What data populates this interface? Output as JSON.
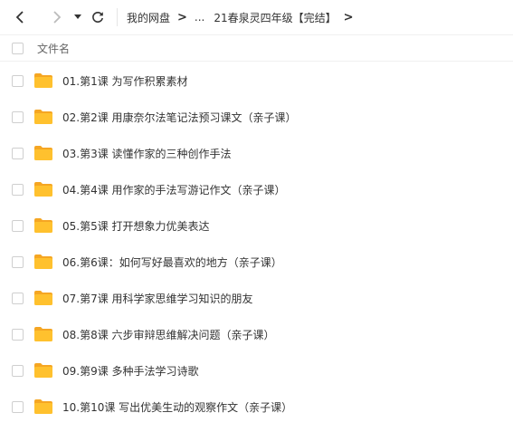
{
  "toolbar": {
    "breadcrumb": {
      "root": "我的网盘",
      "ellipsis": "...",
      "current": "21春泉灵四年级【完结】"
    }
  },
  "list_header": {
    "name_column": "文件名"
  },
  "files": [
    {
      "name": "01.第1课 为写作积累素材"
    },
    {
      "name": "02.第2课 用康奈尔法笔记法预习课文（亲子课）"
    },
    {
      "name": "03.第3课 读懂作家的三种创作手法"
    },
    {
      "name": "04.第4课 用作家的手法写游记作文（亲子课）"
    },
    {
      "name": "05.第5课 打开想象力优美表达"
    },
    {
      "name": "06.第6课：如何写好最喜欢的地方（亲子课）"
    },
    {
      "name": "07.第7课 用科学家思维学习知识的朋友"
    },
    {
      "name": "08.第8课 六步审辩思维解决问题（亲子课）"
    },
    {
      "name": "09.第9课 多种手法学习诗歌"
    },
    {
      "name": "10.第10课 写出优美生动的观察作文（亲子课）"
    }
  ],
  "icons": {
    "folder_color": "#FFC12E",
    "folder_tab_color": "#F5A623",
    "back": "chevron-left-icon",
    "forward": "chevron-right-icon",
    "history": "caret-down-icon",
    "refresh": "refresh-icon"
  }
}
